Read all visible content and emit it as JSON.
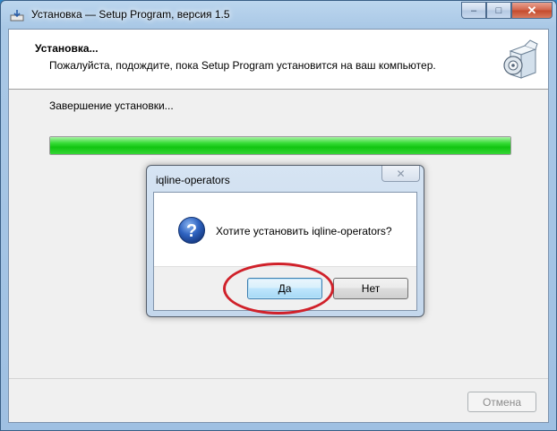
{
  "window": {
    "title": "Установка — Setup Program, версия 1.5",
    "controls": {
      "minimize": "–",
      "maximize": "□",
      "close": "✕"
    }
  },
  "header": {
    "title": "Установка...",
    "subtitle": "Пожалуйста, подождите, пока Setup Program установится на ваш компьютер."
  },
  "status": {
    "text": "Завершение установки..."
  },
  "progress": {
    "fraction": 1.0
  },
  "footer": {
    "cancel_label": "Отмена"
  },
  "dialog": {
    "title": "iqline-operators",
    "close": "✕",
    "message": "Хотите установить iqline-operators?",
    "yes_label": "Да",
    "no_label": "Нет"
  },
  "colors": {
    "progress_green": "#11c511",
    "annotation_red": "#d0212a",
    "question_icon_blue": "#1f4fa8"
  },
  "icons": [
    "installer-icon",
    "setup-box-icon",
    "question-icon"
  ]
}
